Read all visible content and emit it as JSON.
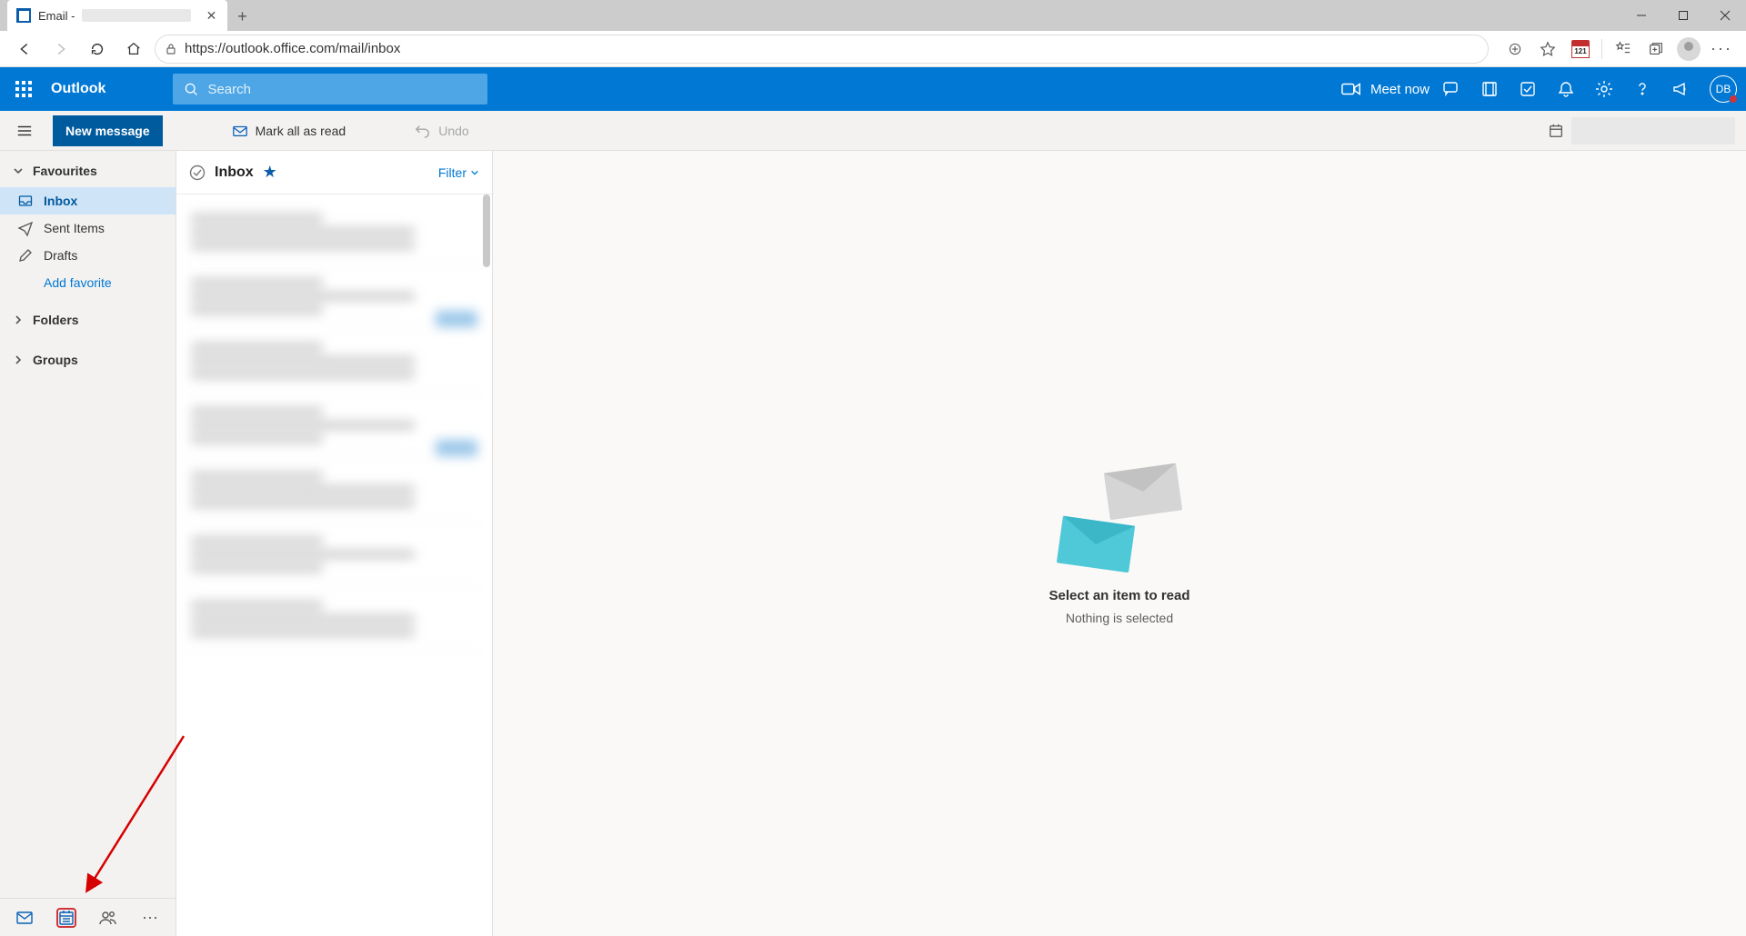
{
  "browser": {
    "tab_title_prefix": "Email -",
    "url": "https://outlook.office.com/mail/inbox",
    "calendar_badge": "121"
  },
  "suitebar": {
    "brand": "Outlook",
    "search_placeholder": "Search",
    "meet_now": "Meet now",
    "initials": "DB"
  },
  "commandbar": {
    "new_message": "New message",
    "mark_all_read": "Mark all as read",
    "undo": "Undo"
  },
  "nav": {
    "favourites": "Favourites",
    "items": [
      {
        "label": "Inbox",
        "icon": "inbox",
        "active": true
      },
      {
        "label": "Sent Items",
        "icon": "send",
        "active": false
      },
      {
        "label": "Drafts",
        "icon": "pencil",
        "active": false
      }
    ],
    "add_favorite": "Add favorite",
    "folders": "Folders",
    "groups": "Groups"
  },
  "listpane": {
    "title": "Inbox",
    "filter": "Filter"
  },
  "reading": {
    "heading": "Select an item to read",
    "sub": "Nothing is selected"
  }
}
